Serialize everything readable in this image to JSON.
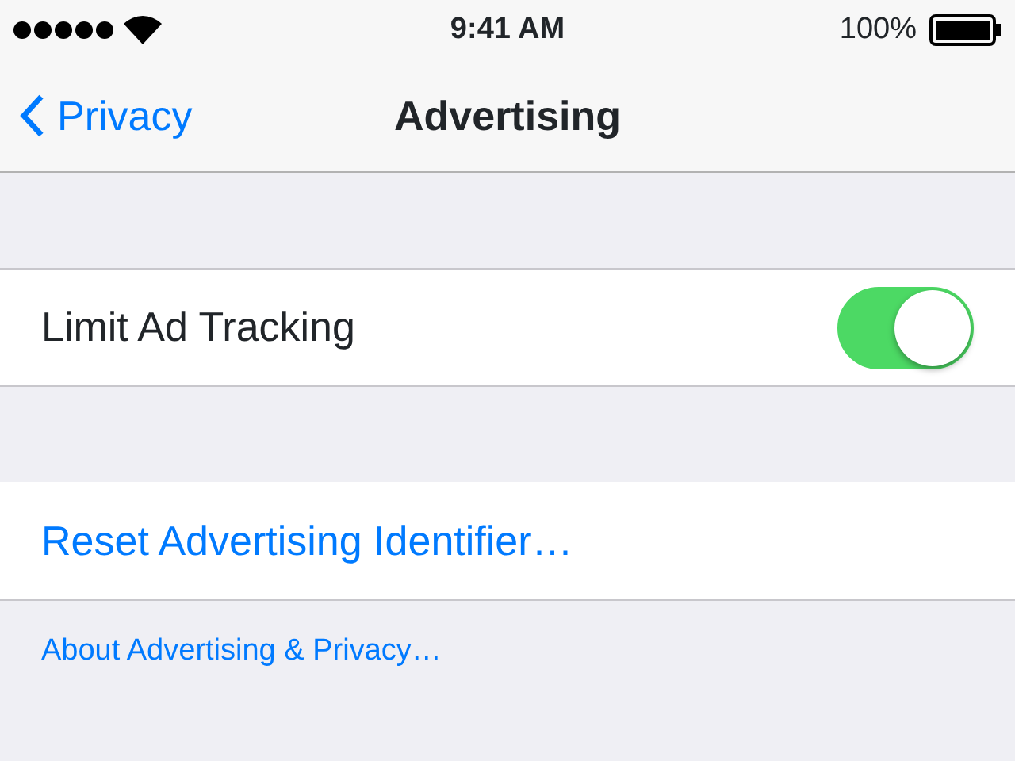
{
  "status_bar": {
    "time": "9:41 AM",
    "battery": "100%"
  },
  "nav": {
    "back": "Privacy",
    "title": "Advertising"
  },
  "rows": [
    {
      "kind": "toggle",
      "label": "Limit Ad Tracking",
      "on": true
    },
    {
      "kind": "link",
      "label": "Reset Advertising Identifier…"
    }
  ],
  "footer_link": "About Advertising & Privacy…"
}
